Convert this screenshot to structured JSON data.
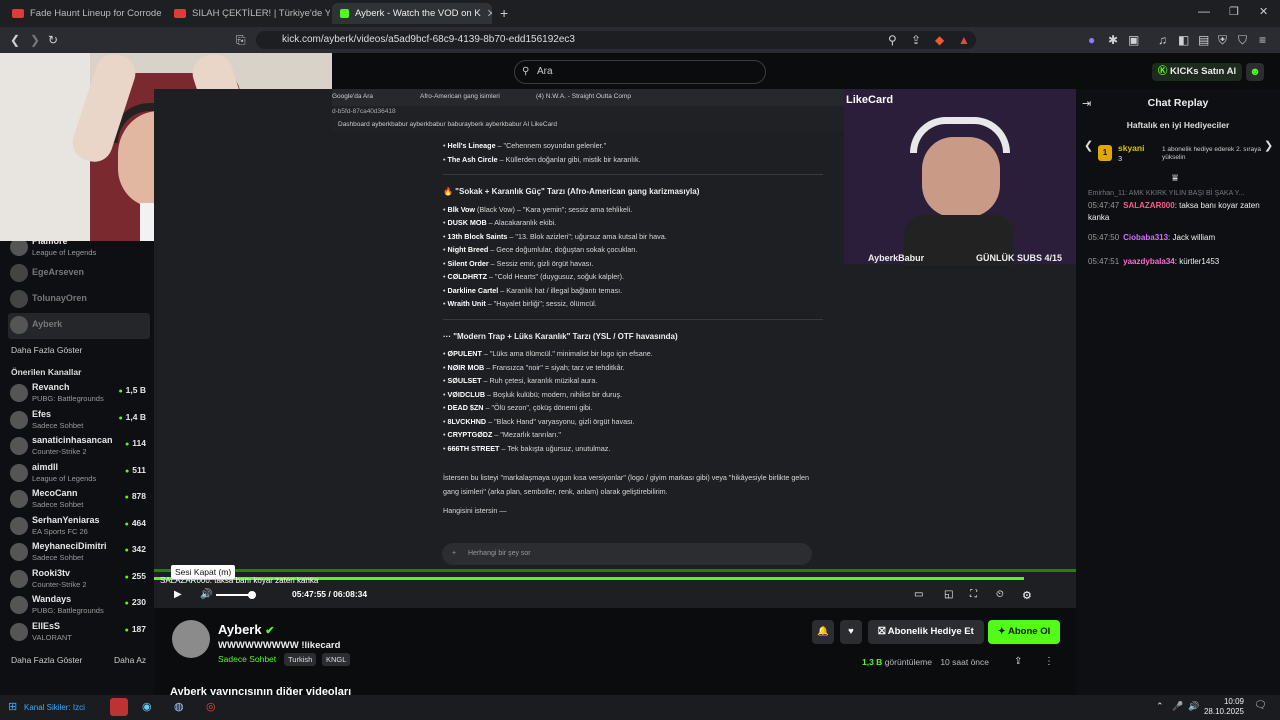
{
  "tabs": [
    {
      "label": "Fade Haunt Lineup for Corrode A Site",
      "color": "#e03a3a"
    },
    {
      "label": "SILAH ÇEKTİLER! | Türkiye'de Yaşanan",
      "color": "#e03a3a"
    },
    {
      "label": "Ayberk - Watch the VOD on K",
      "color": "#53fc18"
    }
  ],
  "url": "kick.com/ayberk/videos/a5ad9bcf-68c9-4139-8b70-edd156192ec3",
  "search_placeholder": "Ara",
  "kicks_button": "KICKs Satın Al",
  "sidebar": {
    "top_channels": [
      {
        "name": "Plamore",
        "game": "League of Legends"
      },
      {
        "name": "EgeArseven",
        "game": ""
      },
      {
        "name": "TolunayOren",
        "game": ""
      },
      {
        "name": "Ayberk",
        "game": ""
      }
    ],
    "show_more": "Daha Fazla Göster",
    "recommended_title": "Önerilen Kanallar",
    "recommended": [
      {
        "name": "Revanch",
        "game": "PUBG: Battlegrounds",
        "count": "1,5 B"
      },
      {
        "name": "Efes",
        "game": "Sadece Sohbet",
        "count": "1,4 B"
      },
      {
        "name": "sanaticinhasancan",
        "game": "Counter-Strike 2",
        "count": "114"
      },
      {
        "name": "aimdll",
        "game": "League of Legends",
        "count": "511"
      },
      {
        "name": "MecoCann",
        "game": "Sadece Sohbet",
        "count": "878"
      },
      {
        "name": "SerhanYeniaras",
        "game": "EA Sports FC 26",
        "count": "464"
      },
      {
        "name": "MeyhaneciDimitri",
        "game": "Sadece Sohbet",
        "count": "342"
      },
      {
        "name": "Rooki3tv",
        "game": "Counter-Strike 2",
        "count": "255"
      },
      {
        "name": "Wandays",
        "game": "PUBG: Battlegrounds",
        "count": "230"
      },
      {
        "name": "ElIEsS",
        "game": "VALORANT",
        "count": "187"
      }
    ],
    "show_more2": "Daha Fazla Göster",
    "show_less": "Daha Az"
  },
  "video": {
    "inner_tabs": [
      "Google'da Ara",
      "Afro-American gang isimleri",
      "(4) N.W.A. - Straight Outta Comp"
    ],
    "inner_url": "d-b5fd-87ca40d36418",
    "bookmarks": "Dashboard   ayberkbabur   ayberkbabur   baburayberk   ayberkbabur   AI   LikeCard",
    "doc": {
      "top_items": [
        {
          "name": "Hell's Lineage",
          "desc": " – \"Cehennem soyundan gelenler.\""
        },
        {
          "name": "The Ash Circle",
          "desc": " – Küllerden doğanlar gibi, mistik bir karanlık."
        }
      ],
      "section1_title": "🔥 \"Sokak + Karanlık Güç\" Tarzı (Afro-American gang karizmasıyla)",
      "section1": [
        {
          "name": "Blk Vow",
          "desc": " (Black Vow) – \"Kara yemin\"; sessiz ama tehlikeli."
        },
        {
          "name": "DUSK MOB",
          "desc": " – Alacakaranlık ekibi."
        },
        {
          "name": "13th Block Saints",
          "desc": " – \"13. Blok azizleri\"; uğursuz ama kutsal bir hava."
        },
        {
          "name": "Night Breed",
          "desc": " – Gece doğumlular, doğuştan sokak çocukları."
        },
        {
          "name": "Silent Order",
          "desc": " – Sessiz emir, gizli örgüt havası."
        },
        {
          "name": "CØLDHRTZ",
          "desc": " – \"Cold Hearts\" (duygusuz, soğuk kalpler)."
        },
        {
          "name": "Darkline Cartel",
          "desc": " – Karanlık hat / illegal bağlantı teması."
        },
        {
          "name": "Wraith Unit",
          "desc": " – \"Hayalet birliği\"; sessiz, ölümcül."
        }
      ],
      "section2_title": "··· \"Modern Trap + Lüks Karanlık\" Tarzı (YSL / OTF havasında)",
      "section2": [
        {
          "name": "ØPULENT",
          "desc": " – \"Lüks ama ölümcül.\" minimalist bir logo için efsane."
        },
        {
          "name": "NØIR MOB",
          "desc": " – Fransızca \"noir\" = siyah; tarz ve tehditkâr."
        },
        {
          "name": "SØULSET",
          "desc": " – Ruh çetesi, karanlık müzikal aura."
        },
        {
          "name": "VØIDCLUB",
          "desc": " – Boşluk kulübü; modern, nihilist bir duruş."
        },
        {
          "name": "DEAD $ZN",
          "desc": " – \"Ölü sezon\", çöküş dönemi gibi."
        },
        {
          "name": "8LVCKHND",
          "desc": " – \"Black Hand\" varyasyonu, gizli örgüt havası."
        },
        {
          "name": "CRYPTGØDZ",
          "desc": " – \"Mezarlık tanrıları.\""
        },
        {
          "name": "666TH STREET",
          "desc": " – Tek bakışta uğursuz, unutulmaz."
        }
      ],
      "closing": "İstersen bu listeyi \"markalaşmaya uygun kısa versiyonlar\" (logo / giyim markası gibi) veya \"hikâyesiyle birlikte gelen gang isimleri\" (arka plan, semboller, renk, anlam) olarak geliştirebilirim.",
      "question": "Hangisini istersin —",
      "ask_placeholder": "Herhangi bir şey sor"
    },
    "likecard": "LikeCard",
    "cam_name": "AyberkBabur",
    "subs": "GÜNLÜK SUBS 4/15",
    "overlay_chat": "SALAZAR000: taksa banı koyar zaten kanka",
    "tooltip": "Sesi Kapat (m)",
    "time": "05:47:55 / 06:08:34",
    "progress": 0.944
  },
  "chat": {
    "title": "Chat Replay",
    "gifters_title": "Haftalık en iyi Hediyeciler",
    "gifter": {
      "name": "skyani",
      "count": "3",
      "rank": "1"
    },
    "gifter_note": "1 abonelik hediye ederek 2. sıraya yükselin",
    "faded_msg": "Emirhan_11: AMK KKIRK YILIN BAŞI Bİ ŞAKA Y...",
    "messages": [
      {
        "time": "05:47:47",
        "user": "SALAZAR000",
        "color": "#ff5c8a",
        "text": "taksa banı koyar zaten kanka"
      },
      {
        "time": "05:47:50",
        "user": "Ciobaba313",
        "color": "#d86bff",
        "text": "Jack william"
      },
      {
        "time": "05:47:51",
        "user": "yaazdybala34",
        "color": "#ff6ad5",
        "text": "kürtler1453"
      }
    ]
  },
  "below": {
    "name": "Ayberk",
    "title": "WWWWWWWWW !likecard",
    "category": "Sadece Sohbet",
    "tags": [
      "Turkish",
      "KNGL"
    ],
    "sub_gift": "Abonelik Hediye Et",
    "subscribe": "Abone Ol",
    "views": "1,3 B",
    "views_label": " görüntüleme",
    "ago": "10 saat önce",
    "other_videos": "Ayberk yayıncısının diğer videoları"
  },
  "taskbar": {
    "overlay": "Kanal Sikiler: Izci",
    "time": "10:09",
    "date": "28.10.2025"
  },
  "colors": {
    "kick_green": "#53fc18"
  }
}
